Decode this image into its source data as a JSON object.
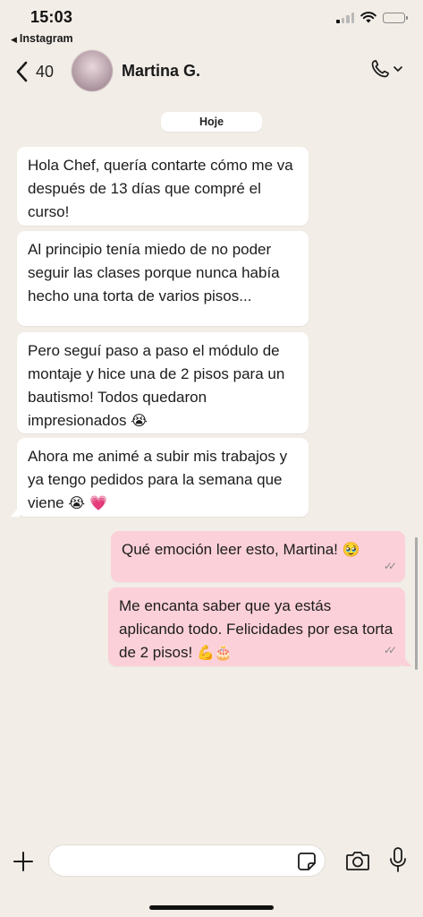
{
  "status_bar": {
    "time": "15:03",
    "back_app": "Instagram"
  },
  "header": {
    "back_count": "40",
    "contact_name": "Martina G."
  },
  "date_chip": "Hoje",
  "messages": [
    {
      "direction": "incoming",
      "text": "Hola Chef, quería contarte cómo me va después de 13 días que compré el curso!"
    },
    {
      "direction": "incoming",
      "text": "Al principio tenía miedo de no poder seguir las clases porque nunca había hecho una torta de varios pisos..."
    },
    {
      "direction": "incoming",
      "text": "Pero seguí paso a paso el módulo de montaje y hice una de 2 pisos para un bautismo! Todos quedaron impresionados",
      "emoji": "😭"
    },
    {
      "direction": "incoming",
      "text": "Ahora me animé a subir mis trabajos y ya tengo pedidos para la semana que viene",
      "emoji": "😭 💗"
    },
    {
      "direction": "outgoing",
      "text": "Qué emoción leer esto, Martina!",
      "emoji": "🥹",
      "ticks": "✓✓"
    },
    {
      "direction": "outgoing",
      "text": "Me encanta saber que ya estás aplicando todo. Felicidades por esa torta de 2 pisos!",
      "emoji": "💪🎂",
      "ticks": "✓✓"
    }
  ],
  "icons": {
    "back": "chevron-left-icon",
    "call": "phone-icon",
    "plus": "plus-icon",
    "sticker": "sticker-icon",
    "camera": "camera-icon",
    "mic": "microphone-icon"
  },
  "colors": {
    "background": "#f2ede6",
    "incoming_bubble": "#ffffff",
    "outgoing_bubble": "#fbd0d9"
  }
}
